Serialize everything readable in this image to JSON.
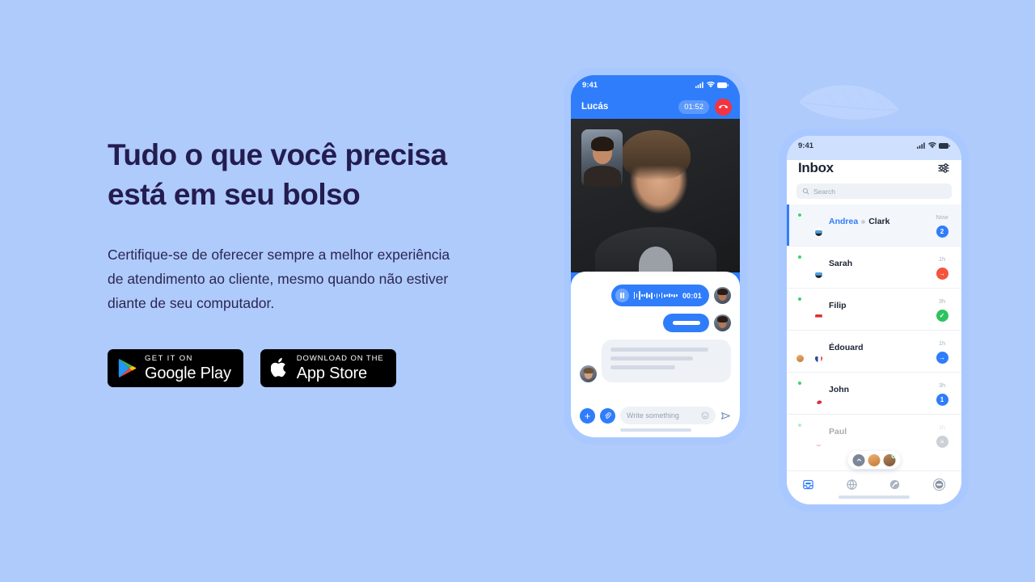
{
  "theme": {
    "background": "#aecbfc",
    "heading_color": "#241c4f",
    "accent_blue": "#2f7dfb",
    "phone_frame": "#a9c8ff",
    "red": "#f5333f",
    "green": "#2ec35e",
    "orange_red": "#f5543c"
  },
  "hero": {
    "headline_line1": "Tudo o que você precisa",
    "headline_line2": "está em seu bolso",
    "paragraph": "Certifique-se de oferecer sempre a melhor experiência de atendimento ao cliente, mesmo quando não estiver diante de seu computador."
  },
  "badges": [
    {
      "id": "google-play",
      "top": "GET IT ON",
      "bottom": "Google Play",
      "icon": "google-play-icon"
    },
    {
      "id": "app-store",
      "top": "Download on the",
      "bottom": "App Store",
      "icon": "apple-logo-icon"
    }
  ],
  "call_phone": {
    "status": {
      "time": "9:41",
      "icons": [
        "cellular-signal-icon",
        "wifi-icon",
        "battery-icon"
      ]
    },
    "header": {
      "name": "Lucás",
      "timer": "01:52",
      "end_call": "end-call-button"
    },
    "voice_message": {
      "duration": "00:01",
      "state": "playing",
      "control": "pause-button"
    },
    "composer": {
      "placeholder": "Write something",
      "plus": "+",
      "attach": "attachment-icon",
      "emoji": "emoji-icon",
      "send": "send-icon"
    }
  },
  "inbox_phone": {
    "status": {
      "time": "9:41",
      "icons": [
        "cellular-signal-icon",
        "wifi-icon",
        "battery-icon"
      ]
    },
    "title": "Inbox",
    "filter_icon": "filter-sliders-icon",
    "search": {
      "placeholder": "Search",
      "icon": "search-icon"
    },
    "conversations": [
      {
        "name_primary": "Andrea",
        "name_secondary": "Clark",
        "time": "Now",
        "badge": "2",
        "badge_type": "count",
        "badge_color": "#2f7dfb",
        "online": true,
        "active": true,
        "flag": "estonia"
      },
      {
        "name_primary": "Sarah",
        "name_secondary": "",
        "time": "1h",
        "badge": "→",
        "badge_type": "arrow",
        "badge_color": "#f5543c",
        "online": true,
        "active": false,
        "flag": "estonia"
      },
      {
        "name_primary": "Filip",
        "name_secondary": "",
        "time": "3h",
        "badge": "✓",
        "badge_type": "check",
        "badge_color": "#2ec35e",
        "online": true,
        "active": false,
        "flag": "croatia"
      },
      {
        "name_primary": "Édouard",
        "name_secondary": "",
        "time": "1h",
        "badge": "→",
        "badge_type": "arrow",
        "badge_color": "#2f7dfb",
        "online": false,
        "active": false,
        "flag": "france"
      },
      {
        "name_primary": "John",
        "name_secondary": "",
        "time": "3h",
        "badge": "1",
        "badge_type": "count",
        "badge_color": "#2f7dfb",
        "online": true,
        "active": false,
        "flag": "japan"
      },
      {
        "name_primary": "Paul",
        "name_secondary": "",
        "time": "1h",
        "badge": "≡",
        "badge_type": "menu",
        "badge_color": "#7b8798",
        "online": true,
        "active": false,
        "flag": "poland"
      }
    ],
    "overlay_pill": {
      "chevron": "chevron-up-icon",
      "avatars": 2
    },
    "tabs": [
      {
        "id": "inbox",
        "icon": "inbox-tray-icon",
        "active": true
      },
      {
        "id": "globe",
        "icon": "globe-icon",
        "active": false
      },
      {
        "id": "reports",
        "icon": "reports-globe-icon",
        "active": false
      },
      {
        "id": "profile",
        "icon": "profile-avatar-icon",
        "active": false
      }
    ]
  },
  "decor": {
    "leaf": "leaf-decoration"
  }
}
